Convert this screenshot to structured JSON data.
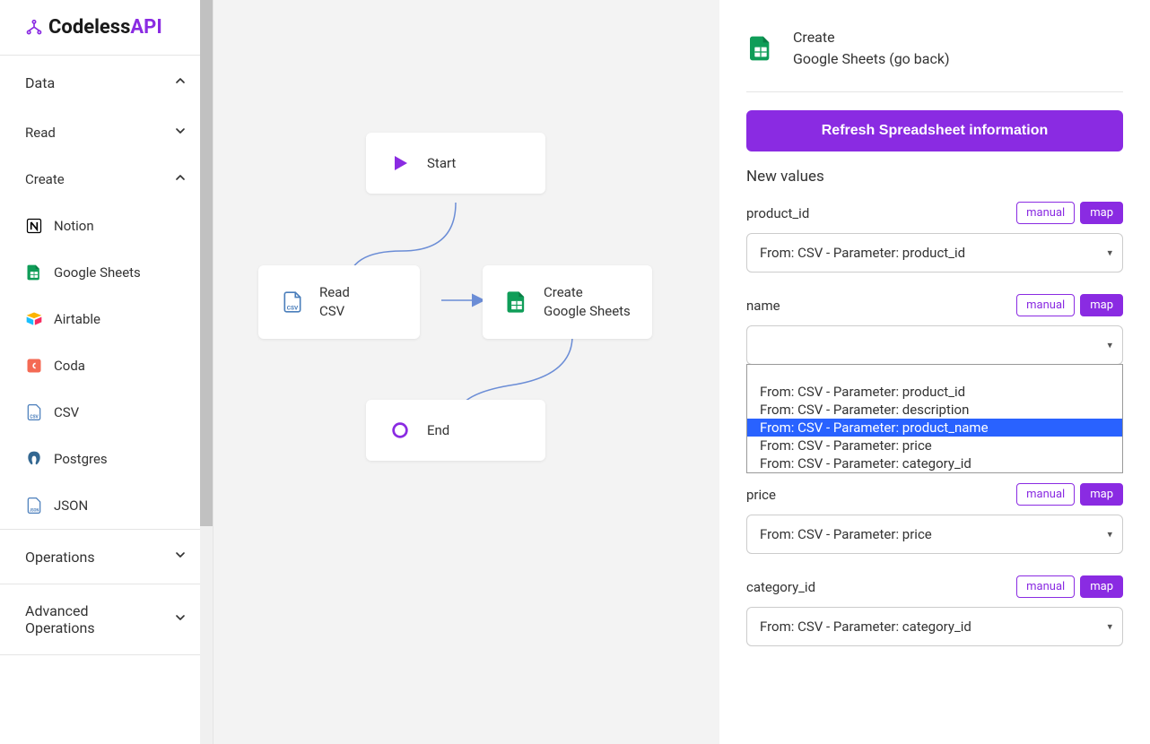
{
  "brand": {
    "name_prefix": "Codeless",
    "name_suffix": "API"
  },
  "sidebar": {
    "data_label": "Data",
    "read_label": "Read",
    "create_label": "Create",
    "create_items": [
      {
        "label": "Notion"
      },
      {
        "label": "Google Sheets"
      },
      {
        "label": "Airtable"
      },
      {
        "label": "Coda"
      },
      {
        "label": "CSV"
      },
      {
        "label": "Postgres"
      },
      {
        "label": "JSON"
      }
    ],
    "operations_label": "Operations",
    "advanced_label": "Advanced Operations"
  },
  "canvas": {
    "start_label": "Start",
    "read_csv_line1": "Read",
    "read_csv_line2": "CSV",
    "create_gs_line1": "Create",
    "create_gs_line2": "Google Sheets",
    "end_label": "End"
  },
  "panel": {
    "header_title": "Create",
    "header_subtitle": "Google Sheets (go back)",
    "refresh_label": "Refresh Spreadsheet information",
    "new_values_label": "New values",
    "manual_label": "manual",
    "map_label": "map",
    "fields": [
      {
        "name": "product_id",
        "value": "From: CSV - Parameter: product_id"
      },
      {
        "name": "name",
        "value": ""
      },
      {
        "name": "price",
        "value": "From: CSV - Parameter: price"
      },
      {
        "name": "category_id",
        "value": "From: CSV - Parameter: category_id"
      }
    ],
    "dropdown_options": [
      "From: CSV - Parameter: product_id",
      "From: CSV - Parameter: description",
      "From: CSV - Parameter: product_name",
      "From: CSV - Parameter: price",
      "From: CSV - Parameter: category_id"
    ],
    "dropdown_selected_index": 2
  }
}
